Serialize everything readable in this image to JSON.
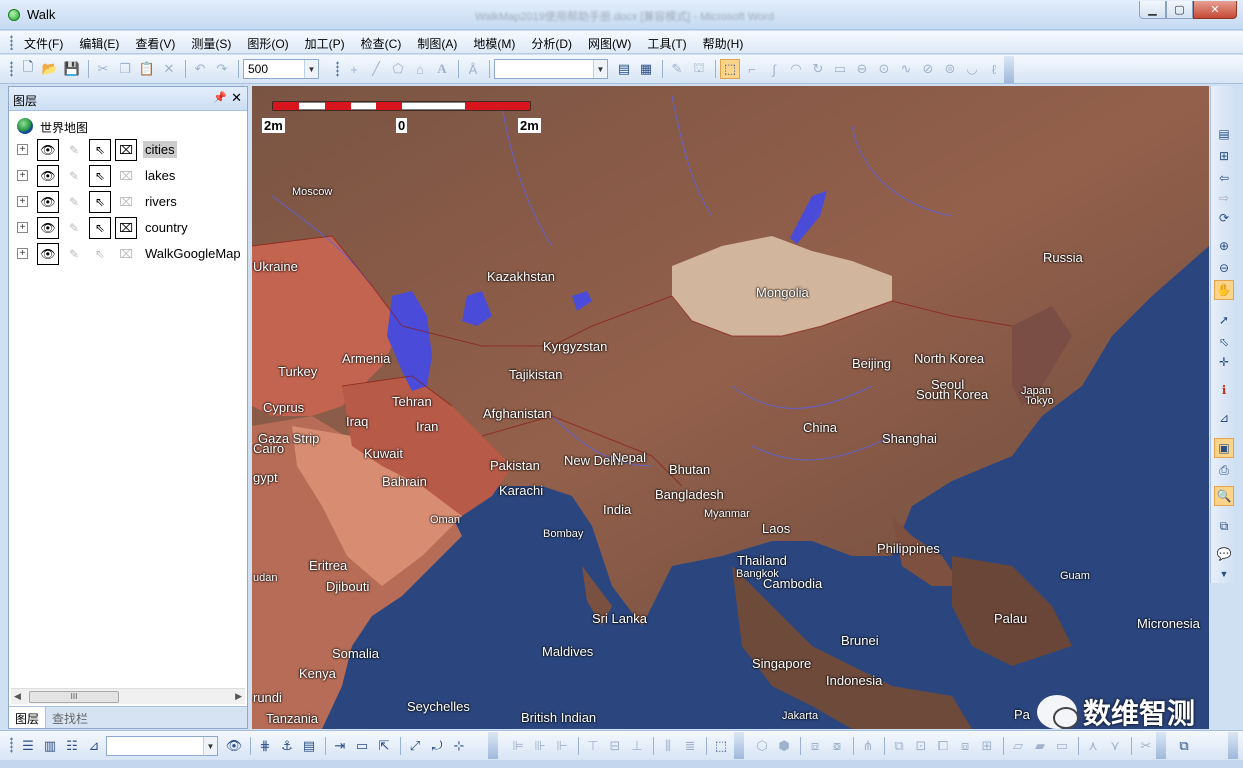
{
  "window": {
    "title": "Walk",
    "background_title": "WalkMap2019使用帮助手册.docx [兼容模式] - Microsoft Word",
    "controls": [
      "minimize",
      "maximize",
      "close"
    ]
  },
  "menu": [
    "文件(F)",
    "编辑(E)",
    "查看(V)",
    "测量(S)",
    "图形(O)",
    "加工(P)",
    "检查(C)",
    "制图(A)",
    "地模(M)",
    "分析(D)",
    "网图(W)",
    "工具(T)",
    "帮助(H)"
  ],
  "toolbar": {
    "scale_combo_value": "500",
    "style_combo_value": "",
    "icons": [
      "new-icon",
      "open-icon",
      "save-icon",
      "cut-icon",
      "copy-icon",
      "paste-icon",
      "delete-icon",
      "undo-icon",
      "redo-icon"
    ]
  },
  "layer_panel": {
    "title": "图层",
    "pin_glyph": "ꝑ",
    "close_glyph": "✕",
    "root": "世界地图",
    "layers": [
      {
        "name": "cities",
        "visible": true,
        "editable": false,
        "selectable": true,
        "labeled": true,
        "selected": true
      },
      {
        "name": "lakes",
        "visible": true,
        "editable": false,
        "selectable": true,
        "labeled": false,
        "selected": false
      },
      {
        "name": "rivers",
        "visible": true,
        "editable": false,
        "selectable": true,
        "labeled": false,
        "selected": false
      },
      {
        "name": "country",
        "visible": true,
        "editable": false,
        "selectable": true,
        "labeled": true,
        "selected": false
      },
      {
        "name": "WalkGoogleMap",
        "visible": true,
        "editable": false,
        "selectable": false,
        "labeled": false,
        "selected": false
      }
    ],
    "tabs": [
      "图层",
      "查找栏"
    ],
    "active_tab": "图层",
    "scroll_grip": "III"
  },
  "map": {
    "scale_labels": [
      "2m",
      "0",
      "2m"
    ],
    "place_labels": [
      "Moscow",
      "Kazakhstan",
      "Mongolia",
      "Russia",
      "Ukraine",
      "Armenia",
      "Turkey",
      "Kyrgyzstan",
      "Tajikistan",
      "Tehran",
      "Cyprus",
      "Iraq",
      "Iran",
      "Afghanistan",
      "Gaza Strip",
      "Cairo",
      "Kuwait",
      "Bahrain",
      "Pakistan",
      "New Delhi",
      "Nepal",
      "Bhutan",
      "Karachi",
      "Bangladesh",
      "India",
      "Myanmar",
      "Oman",
      "Bombay",
      "Laos",
      "Thailand",
      "Bangkok",
      "Cambodia",
      "China",
      "Beijing",
      "North Korea",
      "Seoul",
      "South Korea",
      "Japan",
      "Tokyo",
      "Shanghai",
      "Philippines",
      "Guam",
      "Eritrea",
      "Djibouti",
      "gypt",
      "udan",
      "Somalia",
      "Kenya",
      "rundi",
      "Tanzania",
      "Sri Lanka",
      "Maldives",
      "Seychelles",
      "British Indian",
      "Brunei",
      "Singapore",
      "Palau",
      "Micronesia",
      "Indonesia",
      "Jakarta",
      "Pa"
    ],
    "watermark": "数维智测"
  },
  "colors": {
    "ocean": "#2b467e",
    "land_selected_country": "#c86a55",
    "land_base": "#8a5a46",
    "mongolia_highlight": "#d8bfa5",
    "lake": "#4a4bd8",
    "accent_selected_tool": "#fbd48b"
  }
}
